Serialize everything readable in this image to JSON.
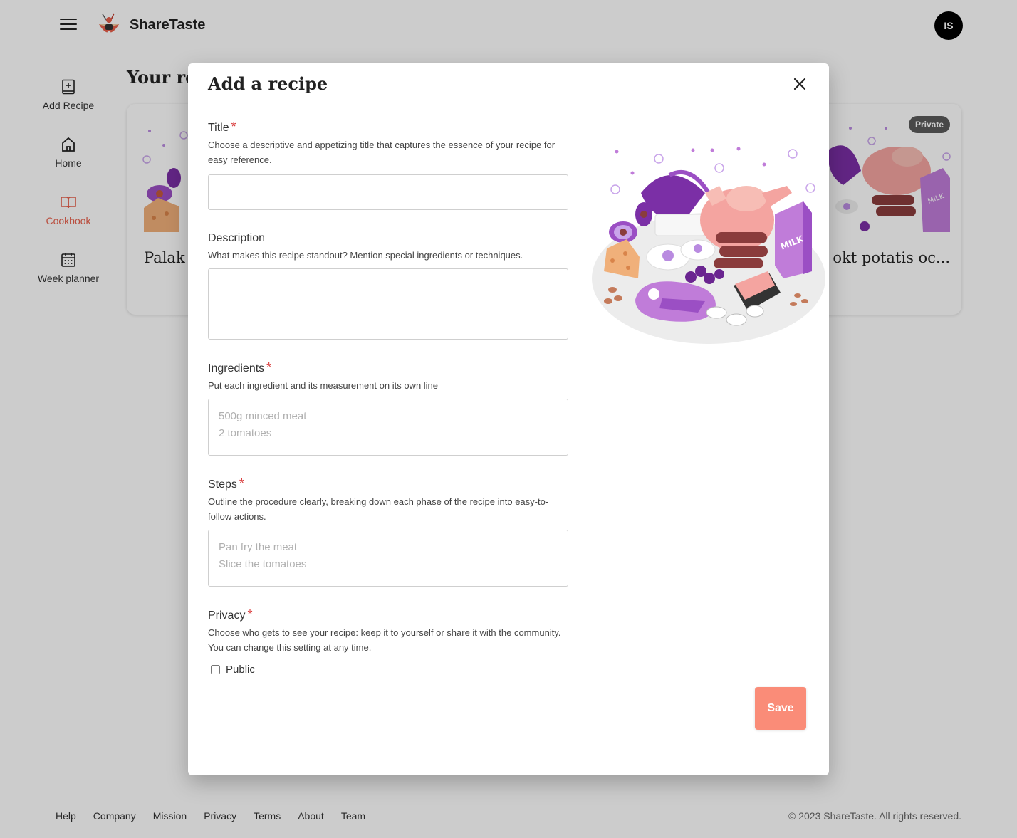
{
  "app": {
    "brand": "ShareTaste",
    "avatar_initials": "IS"
  },
  "sidebar": {
    "items": [
      {
        "label": "Add Recipe",
        "icon": "add-note-icon",
        "active": false
      },
      {
        "label": "Home",
        "icon": "home-icon",
        "active": false
      },
      {
        "label": "Cookbook",
        "icon": "book-icon",
        "active": true
      },
      {
        "label": "Week planner",
        "icon": "calendar-icon",
        "active": false
      }
    ]
  },
  "page": {
    "heading": "Your re"
  },
  "cards": [
    {
      "title": "Palak p tomat",
      "badge": ""
    },
    {
      "title": "s köttbullar okt potatis oc...",
      "badge": "Private"
    }
  ],
  "modal": {
    "title": "Add a recipe",
    "fields": {
      "title": {
        "label": "Title",
        "help": "Choose a descriptive and appetizing title that captures the essence of your recipe for easy reference.",
        "value": ""
      },
      "description": {
        "label": "Description",
        "help": "What makes this recipe standout? Mention special ingredients or techniques.",
        "value": ""
      },
      "ingredients": {
        "label": "Ingredients",
        "help": "Put each ingredient and its measurement on its own line",
        "placeholder": "500g minced meat\n2 tomatoes"
      },
      "steps": {
        "label": "Steps",
        "help": "Outline the procedure clearly, breaking down each phase of the recipe into easy-to-follow actions.",
        "placeholder": "Pan fry the meat\nSlice the tomatoes"
      },
      "privacy": {
        "label": "Privacy",
        "help": "Choose who gets to see your recipe: keep it to yourself or share it with the community. You can change this setting at any time.",
        "checkbox_label": "Public",
        "checked": false
      }
    },
    "save_label": "Save"
  },
  "footer": {
    "links": [
      "Help",
      "Company",
      "Mission",
      "Privacy",
      "Terms",
      "About",
      "Team"
    ],
    "copyright": "© 2023 ShareTaste. All rights reserved."
  },
  "colors": {
    "accent": "#fa8c78",
    "active_nav": "#e8604c",
    "required": "#d93a3a",
    "illustration_purple": "#9b4fc4",
    "illustration_pink": "#f4a4a0"
  }
}
